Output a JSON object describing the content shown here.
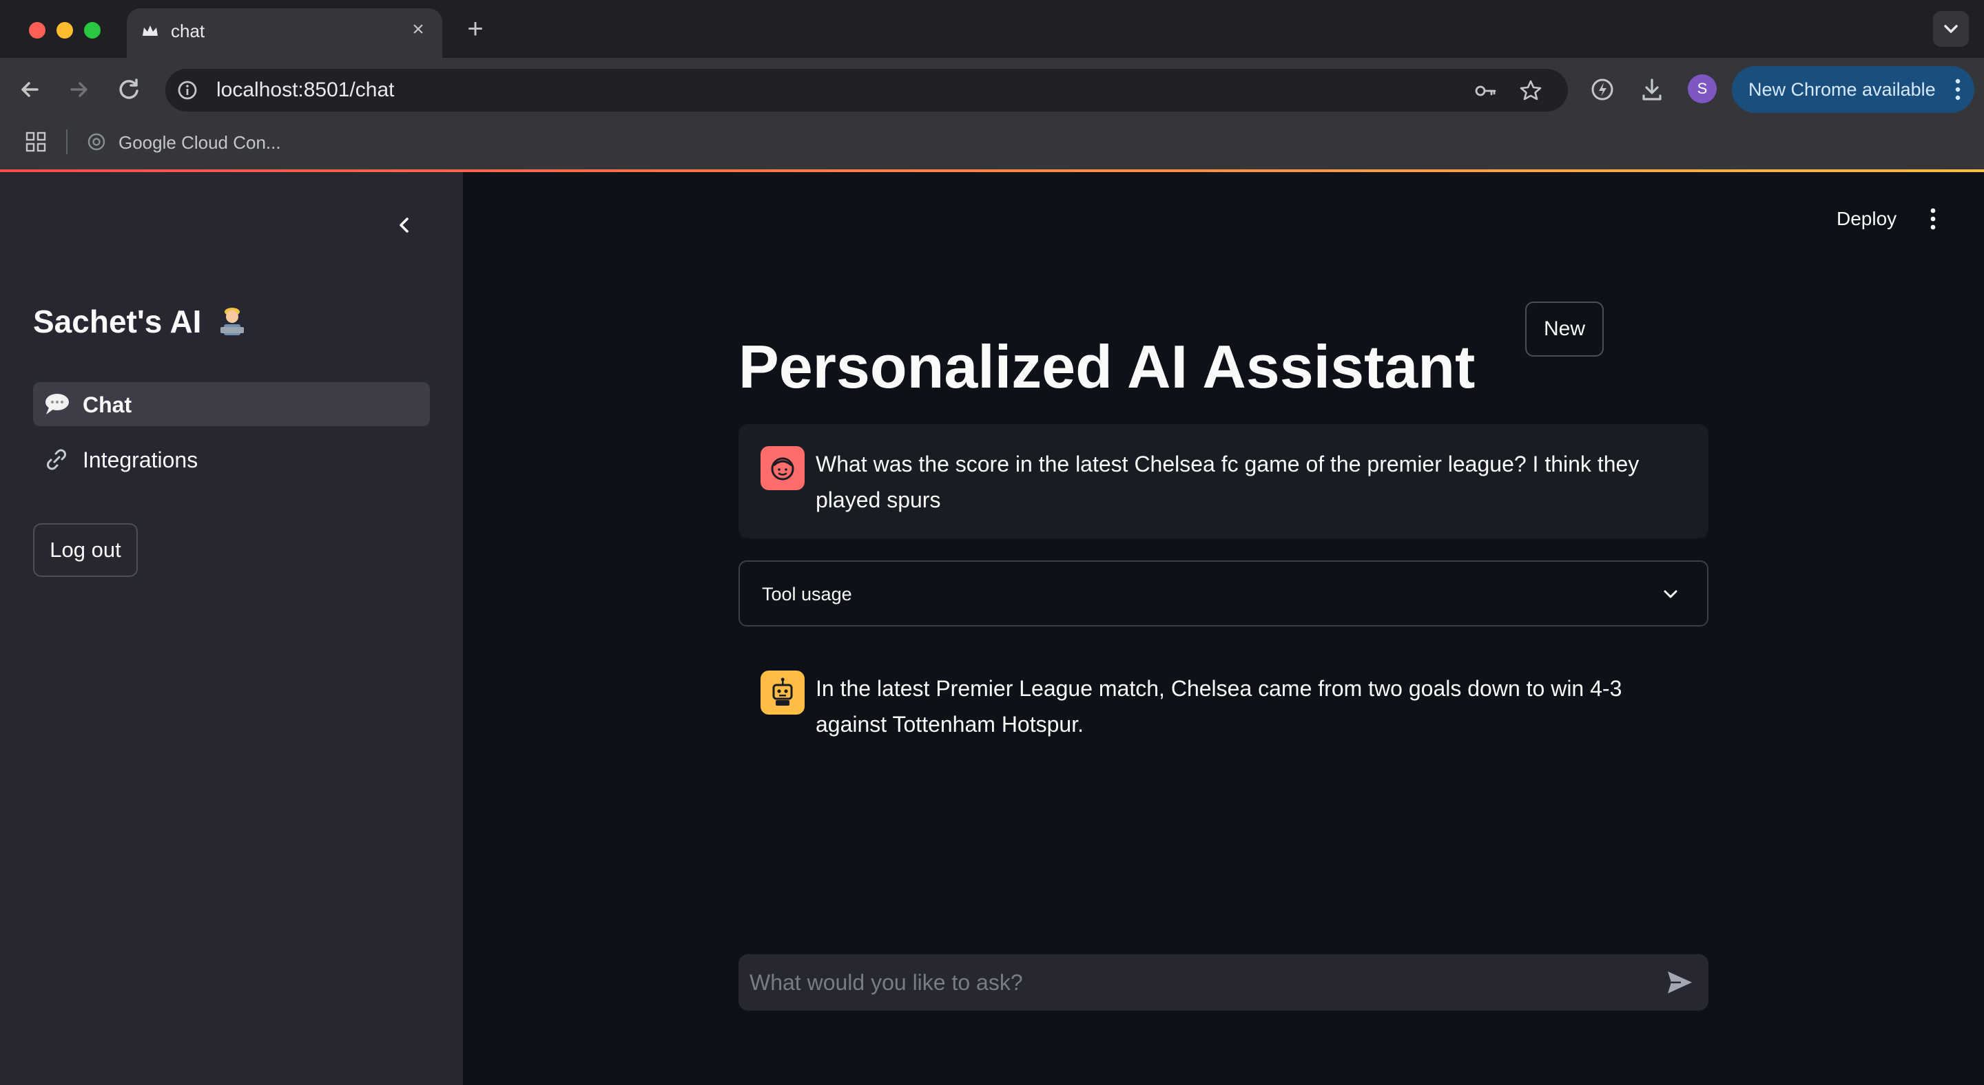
{
  "browser": {
    "tab_title": "chat",
    "url": "localhost:8501/chat",
    "profile_initial": "S",
    "update_label": "New Chrome available",
    "bookmarks": [
      {
        "label": "Google Cloud Con..."
      }
    ]
  },
  "sidebar": {
    "brand": "Sachet's AI",
    "nav": [
      {
        "label": "Chat",
        "icon": "speech-balloon-icon",
        "active": true
      },
      {
        "label": "Integrations",
        "icon": "link-icon",
        "active": false
      }
    ],
    "logout_label": "Log out"
  },
  "header": {
    "deploy_label": "Deploy"
  },
  "main": {
    "new_label": "New",
    "title": "Personalized AI Assistant",
    "messages": [
      {
        "role": "user",
        "text": "What was the score in the latest Chelsea fc game of the premier league? I think they played spurs"
      },
      {
        "role": "assistant",
        "text": "In the latest Premier League match, Chelsea came from two goals down to win 4-3 against Tottenham Hotspur."
      }
    ],
    "expander_label": "Tool usage",
    "input_placeholder": "What would you like to ask?"
  },
  "colors": {
    "accent": "#ff4b4b",
    "user_avatar": "#ff6c6c",
    "assistant_avatar": "#ffbd45",
    "sidebar_bg": "#262730",
    "main_bg": "#0e1117",
    "update_pill": "#1a4f7d",
    "profile": "#7e57c2"
  }
}
